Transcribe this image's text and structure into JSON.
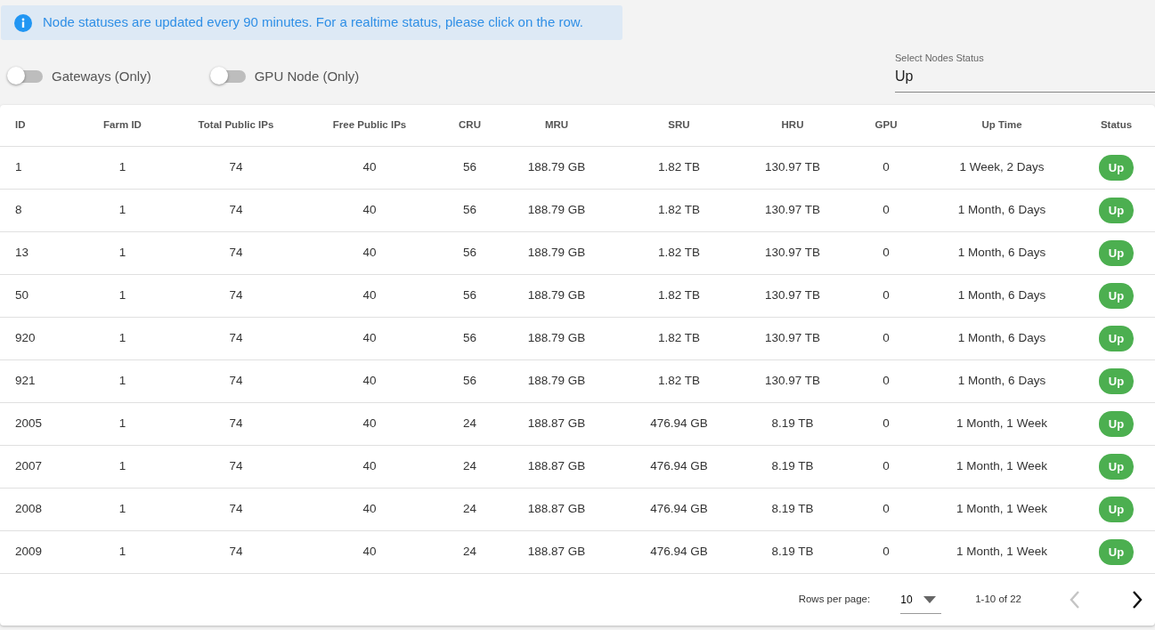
{
  "alert": {
    "text": "Node statuses are updated every 90 minutes. For a realtime status, please click on the row."
  },
  "toggles": [
    {
      "label": "Gateways (Only)",
      "on": false
    },
    {
      "label": "GPU Node (Only)",
      "on": false
    }
  ],
  "status_select": {
    "label": "Select Nodes Status",
    "value": "Up"
  },
  "table": {
    "columns": [
      "ID",
      "Farm ID",
      "Total Public IPs",
      "Free Public IPs",
      "CRU",
      "MRU",
      "SRU",
      "HRU",
      "GPU",
      "Up Time",
      "Status"
    ],
    "rows": [
      [
        "1",
        "1",
        "74",
        "40",
        "56",
        "188.79 GB",
        "1.82 TB",
        "130.97 TB",
        "0",
        "1 Week, 2 Days",
        "Up"
      ],
      [
        "8",
        "1",
        "74",
        "40",
        "56",
        "188.79 GB",
        "1.82 TB",
        "130.97 TB",
        "0",
        "1 Month, 6 Days",
        "Up"
      ],
      [
        "13",
        "1",
        "74",
        "40",
        "56",
        "188.79 GB",
        "1.82 TB",
        "130.97 TB",
        "0",
        "1 Month, 6 Days",
        "Up"
      ],
      [
        "50",
        "1",
        "74",
        "40",
        "56",
        "188.79 GB",
        "1.82 TB",
        "130.97 TB",
        "0",
        "1 Month, 6 Days",
        "Up"
      ],
      [
        "920",
        "1",
        "74",
        "40",
        "56",
        "188.79 GB",
        "1.82 TB",
        "130.97 TB",
        "0",
        "1 Month, 6 Days",
        "Up"
      ],
      [
        "921",
        "1",
        "74",
        "40",
        "56",
        "188.79 GB",
        "1.82 TB",
        "130.97 TB",
        "0",
        "1 Month, 6 Days",
        "Up"
      ],
      [
        "2005",
        "1",
        "74",
        "40",
        "24",
        "188.87 GB",
        "476.94 GB",
        "8.19 TB",
        "0",
        "1 Month, 1 Week",
        "Up"
      ],
      [
        "2007",
        "1",
        "74",
        "40",
        "24",
        "188.87 GB",
        "476.94 GB",
        "8.19 TB",
        "0",
        "1 Month, 1 Week",
        "Up"
      ],
      [
        "2008",
        "1",
        "74",
        "40",
        "24",
        "188.87 GB",
        "476.94 GB",
        "8.19 TB",
        "0",
        "1 Month, 1 Week",
        "Up"
      ],
      [
        "2009",
        "1",
        "74",
        "40",
        "24",
        "188.87 GB",
        "476.94 GB",
        "8.19 TB",
        "0",
        "1 Month, 1 Week",
        "Up"
      ]
    ]
  },
  "pagination": {
    "rows_per_page_label": "Rows per page:",
    "rows_per_page": "10",
    "range": "1-10 of 22",
    "prev_disabled": true,
    "next_disabled": false
  }
}
